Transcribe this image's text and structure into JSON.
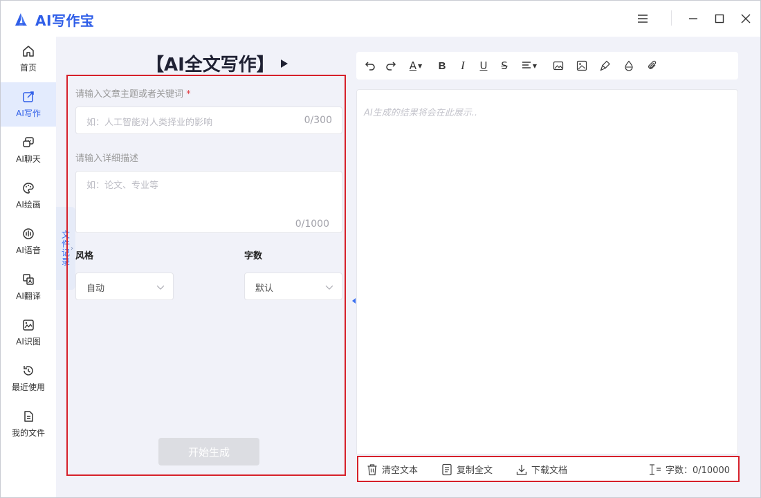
{
  "app": {
    "title": "AI写作宝",
    "brand_color": "#2f5ee8",
    "icons": [
      "menu-icon",
      "minimize-icon",
      "maximize-icon",
      "close-icon"
    ]
  },
  "sidebar": {
    "items": [
      {
        "label": "首页",
        "icon": "home-icon",
        "active": false
      },
      {
        "label": "AI写作",
        "icon": "edit-icon",
        "active": true
      },
      {
        "label": "AI聊天",
        "icon": "chat-icon",
        "active": false
      },
      {
        "label": "AI绘画",
        "icon": "palette-icon",
        "active": false
      },
      {
        "label": "AI语音",
        "icon": "voice-icon",
        "active": false
      },
      {
        "label": "AI翻译",
        "icon": "translate-icon",
        "active": false
      },
      {
        "label": "AI识图",
        "icon": "image-recognition-icon",
        "active": false
      },
      {
        "label": "最近使用",
        "icon": "history-icon",
        "active": false
      },
      {
        "label": "我的文件",
        "icon": "file-icon",
        "active": false
      }
    ]
  },
  "history_tab": {
    "label": "文件记录"
  },
  "writer": {
    "title": "【AI全文写作】",
    "topic": {
      "label": "请输入文章主题或者关键词",
      "required_mark": "*",
      "placeholder": "如：人工智能对人类择业的影响",
      "counter": "0/300"
    },
    "detail": {
      "label": "请输入详细描述",
      "placeholder": "如：论文、专业等",
      "counter": "0/1000"
    },
    "style": {
      "label": "风格",
      "value": "自动"
    },
    "length": {
      "label": "字数",
      "value": "默认"
    },
    "generate_label": "开始生成"
  },
  "editor": {
    "toolbar_icons": [
      "undo-icon",
      "redo-icon",
      "font-color-icon",
      "bold-icon",
      "italic-icon",
      "underline-icon",
      "strikethrough-icon",
      "align-icon",
      "image-icon",
      "image-alt-icon",
      "format-painter-icon",
      "clear-format-icon",
      "attachment-icon"
    ],
    "bold_glyph": "B",
    "italic_glyph": "I",
    "underline_glyph": "U",
    "strike_glyph": "S",
    "font_glyph": "A",
    "placeholder": "AI生成的结果将会在此展示..",
    "clear_label": "清空文本",
    "copy_label": "复制全文",
    "download_label": "下载文档",
    "wordcount_label": "字数：0/10000"
  },
  "colors": {
    "highlight_border": "#d6202a",
    "active_nav_bg": "#e3ebfd"
  }
}
